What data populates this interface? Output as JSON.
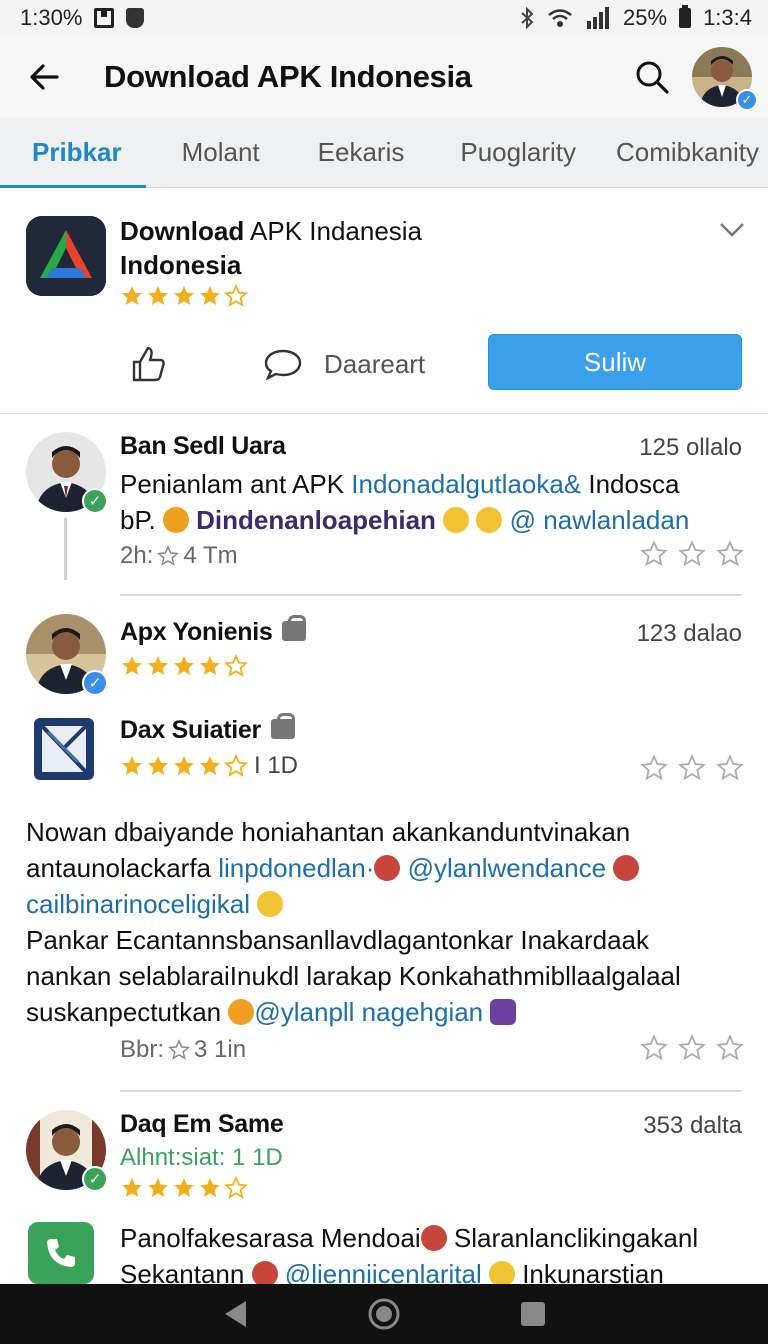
{
  "status_bar": {
    "time_left": "1:30%",
    "battery_text": "25%",
    "time_right": "1:3:4"
  },
  "app_bar": {
    "title": "Download APK Indonesia"
  },
  "tabs": [
    {
      "label": "Pribkar",
      "active": true
    },
    {
      "label": "Molant",
      "active": false
    },
    {
      "label": "Eekaris",
      "active": false
    },
    {
      "label": "Puoglarity",
      "active": false
    },
    {
      "label": "Comibkanity",
      "active": false
    }
  ],
  "app_card": {
    "name_bold": "Download",
    "name_rest": " APK Indanesia",
    "name_line2": "Indonesia",
    "rating_stars": 4,
    "comment_label": "Daareart",
    "primary_button": "Suliw"
  },
  "reviews": [
    {
      "name": "Ban Sedl Uara",
      "meta": "125 ollalo",
      "text_a": "Penianlam ant APK ",
      "text_link1": "Indonadalgutlaoka&",
      "text_b": " Indosca",
      "text_c": "bP. ",
      "text_purple": "Dindenanloapehian",
      "text_link2": "@ nawlanladan",
      "foot_prefix": "2h:",
      "foot_value": "4 Tm"
    },
    {
      "name": "Apx Yonienis",
      "meta": "123 dalao",
      "rating_stars": 4
    },
    {
      "name": "Dax Suiatier",
      "rating_stars": 4,
      "rating_suffix": "I 1D"
    },
    {
      "long_line1": "Nowan dbaiyande honiahantan akankanduntvinakan",
      "long_line2_a": "antaunolackarfa ",
      "long_line2_link": "linpdonedlan·",
      "long_line2_link2": "@ylanlwendance",
      "long_line3_link": "cailbinarinoceligikal",
      "long_line4": "Pankar Ecantannsbansanllavdlagantonkar Inakardaak",
      "long_line5": "nankan selablaraiInukdl larakap Konkahathmibllaalgalaal",
      "long_line6_a": "suskanpectutkan ",
      "long_line6_link": "@ylanpll nagehgian",
      "foot_prefix": "Bbr:",
      "foot_value": "3 1in"
    },
    {
      "name": "Daq Em Same",
      "meta": "353 dalta",
      "sub_green": "Alhnt:siat: 1 1D",
      "rating_stars": 4,
      "text_line1": "Panolfakesarasa Mendoai",
      "text_line1_b": " Slaranlanclikingakanl",
      "text_line2_a": "Sekantann ",
      "text_line2_link": "@lienniicenlarital",
      "text_line2_b": " Inkunarstian"
    }
  ],
  "colors": {
    "accent": "#1e88c8",
    "primary_button": "#3aa0ec",
    "star": "#f2b01e",
    "link": "#1d6fa8",
    "verified": "#3aa35a"
  }
}
